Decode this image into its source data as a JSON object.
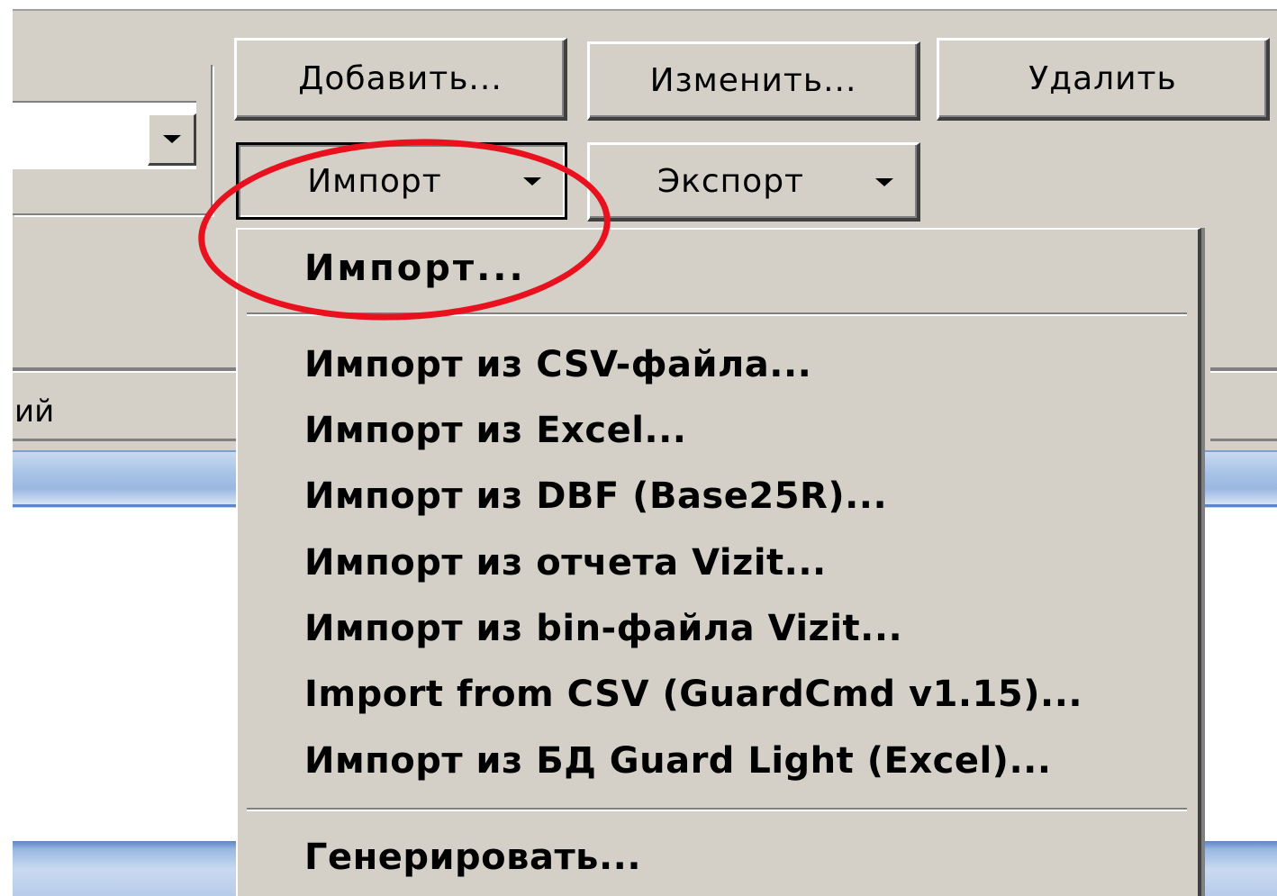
{
  "buttons": {
    "add": "Добавить...",
    "edit": "Изменить...",
    "delete": "Удалить",
    "import": "Импорт",
    "export": "Экспорт"
  },
  "list": {
    "column_header_fragment": "ий"
  },
  "import_menu": {
    "default_item": "Импорт...",
    "items": [
      "Импорт из CSV-файла...",
      "Импорт из Excel...",
      "Импорт из DBF (Base25R)...",
      "Импорт из отчета Vizit...",
      "Импорт из bin-файла Vizit...",
      "Import from CSV (GuardCmd v1.15)...",
      "Импорт из БД Guard Light (Excel)..."
    ],
    "generate_item": "Генерировать..."
  },
  "colors": {
    "window_face": "#d4d0c8",
    "selection_blue": "#9ab8e2",
    "annotation_red": "#e8111d"
  },
  "icons": [
    "dropdown-arrow-icon"
  ]
}
